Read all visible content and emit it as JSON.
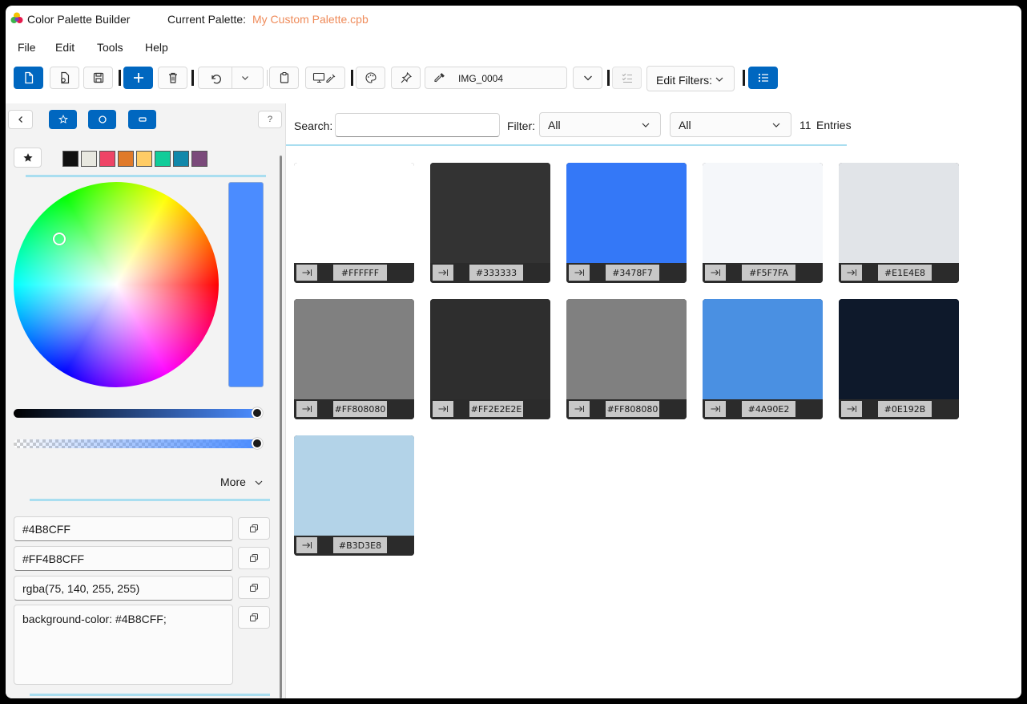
{
  "app": {
    "title": "Color Palette Builder",
    "current_palette_label": "Current Palette:",
    "current_palette_name": "My Custom Palette.cpb",
    "accent_color": "#0067c0",
    "palette_name_color": "#ef8b5a"
  },
  "menu": [
    "File",
    "Edit",
    "Tools",
    "Help"
  ],
  "toolbar": {
    "image_source": "IMG_0004",
    "edit_filters_label": "Edit Filters:"
  },
  "left_panel": {
    "quick_swatches": [
      "#111111",
      "#e8e8e0",
      "#ee4466",
      "#e07a2a",
      "#ffcc66",
      "#11cc99",
      "#1188aa",
      "#7a4a7a"
    ],
    "current_color": "#4B8CFF",
    "brightness_level": 1.0,
    "alpha_level": 1.0,
    "more_label": "More",
    "formats": {
      "hex": "#4B8CFF",
      "argb_hex": "#FF4B8CFF",
      "rgba": "rgba(75, 140, 255, 255)",
      "css": "background-color: #4B8CFF;"
    }
  },
  "search": {
    "label": "Search:",
    "value": ""
  },
  "filter": {
    "label": "Filter:",
    "first_value": "All",
    "second_value": "All"
  },
  "entries": {
    "count": "11",
    "label": "Entries"
  },
  "colors": [
    {
      "hex": "#FFFFFF",
      "swatch": "#FFFFFF"
    },
    {
      "hex": "#333333",
      "swatch": "#333333"
    },
    {
      "hex": "#3478F7",
      "swatch": "#3478F7"
    },
    {
      "hex": "#F5F7FA",
      "swatch": "#F5F7FA"
    },
    {
      "hex": "#E1E4E8",
      "swatch": "#E1E4E8"
    },
    {
      "hex": "#FF808080",
      "swatch": "#808080"
    },
    {
      "hex": "#FF2E2E2E",
      "swatch": "#2E2E2E"
    },
    {
      "hex": "#FF808080",
      "swatch": "#808080"
    },
    {
      "hex": "#4A90E2",
      "swatch": "#4A90E2"
    },
    {
      "hex": "#0E192B",
      "swatch": "#0E192B"
    },
    {
      "hex": "#B3D3E8",
      "swatch": "#B3D3E8"
    }
  ]
}
